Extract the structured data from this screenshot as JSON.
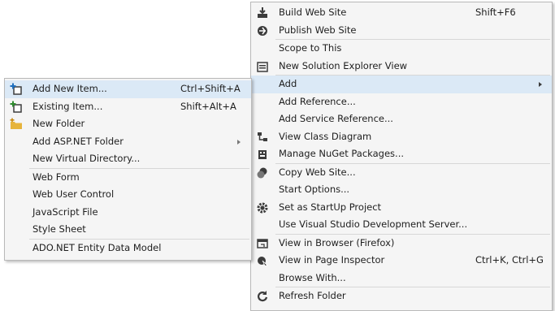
{
  "main_menu": {
    "build_web_site": {
      "label": "Build Web Site",
      "shortcut": "Shift+F6"
    },
    "publish_web_site": {
      "label": "Publish Web Site"
    },
    "scope_to_this": {
      "label": "Scope to This"
    },
    "new_solution_explorer_view": {
      "label": "New Solution Explorer View"
    },
    "add": {
      "label": "Add"
    },
    "add_reference": {
      "label": "Add Reference..."
    },
    "add_service_reference": {
      "label": "Add Service Reference..."
    },
    "view_class_diagram": {
      "label": "View Class Diagram"
    },
    "manage_nuget": {
      "label": "Manage NuGet Packages..."
    },
    "copy_web_site": {
      "label": "Copy Web Site..."
    },
    "start_options": {
      "label": "Start Options..."
    },
    "set_startup": {
      "label": "Set as StartUp Project"
    },
    "use_dev_server": {
      "label": "Use Visual Studio Development Server..."
    },
    "view_in_browser": {
      "label": "View in Browser (Firefox)"
    },
    "view_in_page_inspector": {
      "label": "View in Page Inspector",
      "shortcut": "Ctrl+K, Ctrl+G"
    },
    "browse_with": {
      "label": "Browse With..."
    },
    "refresh_folder": {
      "label": "Refresh Folder"
    }
  },
  "sub_menu": {
    "add_new_item": {
      "label": "Add New Item...",
      "shortcut": "Ctrl+Shift+A"
    },
    "existing_item": {
      "label": "Existing Item...",
      "shortcut": "Shift+Alt+A"
    },
    "new_folder": {
      "label": "New Folder"
    },
    "add_aspnet_folder": {
      "label": "Add ASP.NET Folder"
    },
    "new_virtual_directory": {
      "label": "New Virtual Directory..."
    },
    "web_form": {
      "label": "Web Form"
    },
    "web_user_control": {
      "label": "Web User Control"
    },
    "javascript_file": {
      "label": "JavaScript File"
    },
    "style_sheet": {
      "label": "Style Sheet"
    },
    "ado_net_entity_data_model": {
      "label": "ADO.NET Entity Data Model"
    }
  },
  "colors": {
    "menu_bg": "#f5f5f5",
    "highlight": "#dbe9f6",
    "separator": "#d7d7d7",
    "text": "#1e1e1e",
    "icon": "#3c3c3c",
    "accent": "#1e6fbf",
    "folder": "#e6b43c"
  }
}
